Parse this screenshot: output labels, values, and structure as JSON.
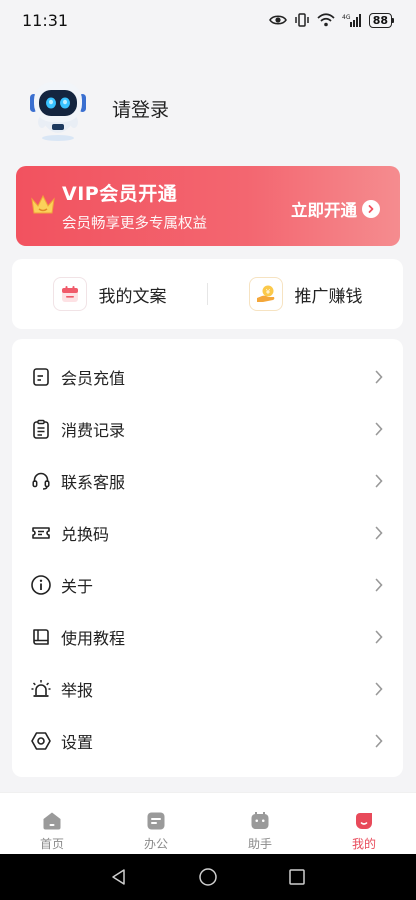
{
  "status_bar": {
    "time": "11:31",
    "battery": "88",
    "network": "4G"
  },
  "profile": {
    "login_text": "请登录"
  },
  "vip": {
    "title": "VIP会员开通",
    "subtitle": "会员畅享更多专属权益",
    "action": "立即开通"
  },
  "quick": {
    "items": [
      {
        "label": "我的文案"
      },
      {
        "label": "推广赚钱"
      }
    ]
  },
  "menu": {
    "items": [
      {
        "label": "会员充值"
      },
      {
        "label": "消费记录"
      },
      {
        "label": "联系客服"
      },
      {
        "label": "兑换码"
      },
      {
        "label": "关于"
      },
      {
        "label": "使用教程"
      },
      {
        "label": "举报"
      },
      {
        "label": "设置"
      }
    ]
  },
  "tabbar": {
    "tabs": [
      {
        "label": "首页"
      },
      {
        "label": "办公"
      },
      {
        "label": "助手"
      },
      {
        "label": "我的",
        "active": true
      }
    ]
  },
  "colors": {
    "accent": "#e84a5a",
    "vip_start": "#f2525f",
    "vip_end": "#f58c8f"
  }
}
